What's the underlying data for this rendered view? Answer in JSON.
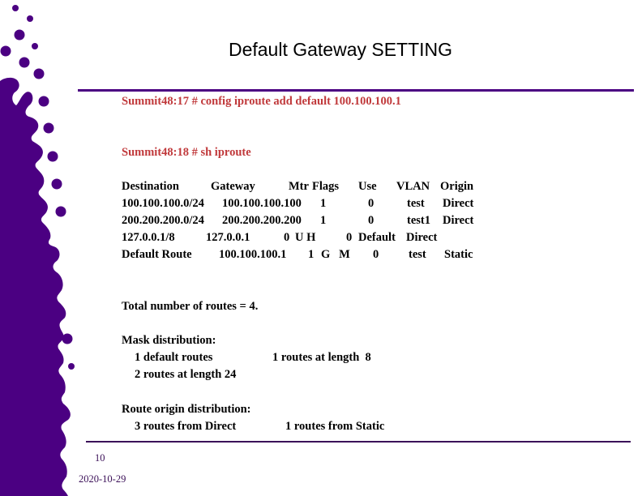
{
  "slide": {
    "title": "Default Gateway SETTING",
    "accent_color": "#4b0082",
    "command_color": "#c0393b",
    "rule_color": "#3b1058"
  },
  "commands": [
    "Summit48:17 # config iproute add default 100.100.100.1",
    "Summit48:18 # sh iproute"
  ],
  "route_table": {
    "headers": [
      "Destination",
      "Gateway",
      "Mtr",
      "Flags",
      "Use",
      "VLAN",
      "Origin"
    ],
    "rows": [
      {
        "destination": "100.100.100.0/24",
        "gateway": "100.100.100.100",
        "mtr": "1",
        "flags": "",
        "use": "0",
        "vlan": "test",
        "origin": "Direct"
      },
      {
        "destination": "200.200.200.0/24",
        "gateway": "200.200.200.200",
        "mtr": "1",
        "flags": "",
        "use": "0",
        "vlan": "test1",
        "origin": "Direct"
      },
      {
        "destination": "127.0.0.1/8",
        "gateway": "127.0.0.1",
        "mtr": "0",
        "flags": "U H",
        "use": "0",
        "vlan": "Default",
        "origin": "Direct"
      },
      {
        "destination": "Default Route",
        "gateway": "100.100.100.1",
        "mtr": "1",
        "flags": "G   M",
        "use": "0",
        "vlan": "test",
        "origin": "Static"
      }
    ]
  },
  "summary": {
    "total": "Total number of routes = 4.",
    "mask_heading": "Mask distribution:",
    "mask_items": [
      "1 default routes",
      "1 routes at length  8",
      "2 routes at length 24"
    ],
    "origin_heading": "Route origin distribution:",
    "origin_items": [
      "3 routes from Direct",
      "1 routes from Static"
    ]
  },
  "footer": {
    "page_number": "10",
    "date": "2020-10-29"
  }
}
